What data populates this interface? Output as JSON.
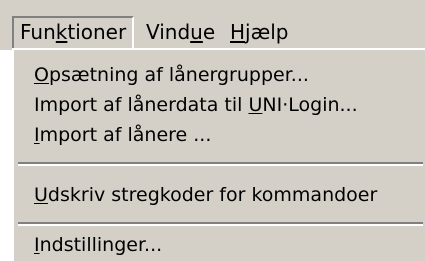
{
  "menubar": {
    "items": [
      {
        "pre": "Fun",
        "key": "k",
        "post": "tioner",
        "active": true
      },
      {
        "pre": "Vind",
        "key": "u",
        "post": "e",
        "active": false
      },
      {
        "pre": "",
        "key": "H",
        "post": "jælp",
        "active": false
      }
    ]
  },
  "menu": {
    "items": [
      {
        "pre": "",
        "key": "O",
        "post": "psætning af lånergrupper..."
      },
      {
        "pre": "Import af lånerdata til ",
        "key": "U",
        "post": "NI·Login..."
      },
      {
        "pre": "",
        "key": "I",
        "post": "mport af lånere ..."
      },
      {
        "pre": "",
        "key": "U",
        "post": "dskriv stregkoder for kommandoer"
      },
      {
        "pre": "",
        "key": "I",
        "post": "ndstillinger..."
      }
    ]
  }
}
